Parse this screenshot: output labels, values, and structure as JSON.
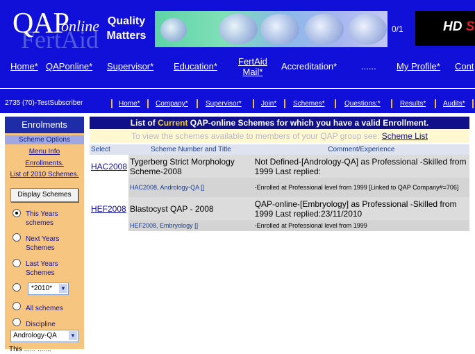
{
  "logo": {
    "qap": "QAP",
    "online": "online",
    "fertaid": "FertAid"
  },
  "tagline": {
    "line1": "Quality",
    "line2": "Matters"
  },
  "counter": "0/1",
  "ad": {
    "hd": "HD",
    "rest": "Sc"
  },
  "nav_main": [
    {
      "label": "Home*"
    },
    {
      "label": "QAPonline*"
    },
    {
      "label": "Supervisor*"
    },
    {
      "label": "Education*"
    },
    {
      "label_line1": "FertAid",
      "label_line2": "Mail*"
    },
    {
      "label": "Accreditation*"
    },
    {
      "label": "......"
    },
    {
      "label": "My Profile*"
    },
    {
      "label": "Cont"
    }
  ],
  "nav_sub": {
    "user": "2735 (70)-TestSubscriber",
    "items": [
      "Home*",
      "Company*",
      "Supervisor*",
      "Join*",
      "Schemes*",
      "Questions:*",
      "Results*",
      "Audits*"
    ]
  },
  "sidebar": {
    "title": "Enrolments",
    "options_label": "Scheme Options",
    "links": [
      "Menu Info",
      "Enrollments.",
      "List of 2010 Schemes."
    ],
    "button": "Display Schemes",
    "radios": [
      {
        "label": "This Years schemes",
        "selected": true
      },
      {
        "label": "Next Years Schemes",
        "selected": false
      },
      {
        "label": "Last Years Schemes",
        "selected": false
      },
      {
        "label": "",
        "selected": false
      },
      {
        "label": "All schemes",
        "selected": false
      },
      {
        "label": "Discipline",
        "selected": false
      }
    ],
    "year_select": "*2010*",
    "discipline_select": "Andrology-QA",
    "bottom_text": "This ...... ......."
  },
  "main": {
    "title_pre": "List of",
    "title_current": "Current",
    "title_post": "QAP-online Schemes for which you have a valid Enrollment.",
    "sub_text": "To view the schemes available to members of your QAP group see:",
    "sub_link": "Scheme List",
    "columns": [
      "Select",
      "Scheme Number and Title",
      "Comment/Experience"
    ],
    "rows": [
      {
        "code": "HAC2008",
        "title": "Tygerberg Strict Morphology Scheme-2008",
        "comment": "Not Defined-[Andrology-QA] as Professional -Skilled from 1999 Last replied:",
        "sub_code": "HAC2008, Andrology-QA []",
        "sub_comment": "-Enrolled at Professional level from 1999 [Linked to QAP Company#=706]"
      },
      {
        "code": "HEF2008",
        "title": "Blastocyst QAP - 2008",
        "comment": "QAP-online-[Embryology] as Professional -Skilled from 1999 Last replied:23/11/2010",
        "sub_code": "HEF2008, Embryology []",
        "sub_comment": "-Enrolled at Professional level from 1999"
      }
    ]
  }
}
